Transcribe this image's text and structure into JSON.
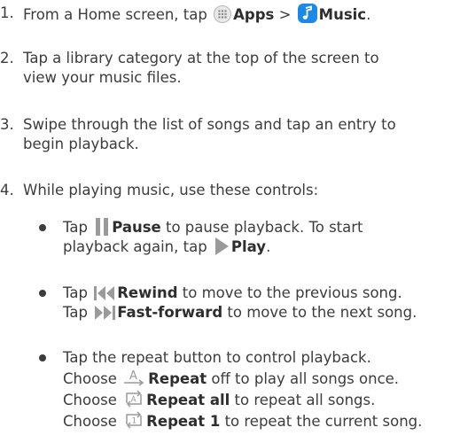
{
  "steps": [
    {
      "num": "1.",
      "pre": "From a Home screen, tap",
      "apps": "Apps",
      "sep": ">",
      "music": "Music",
      "end": "."
    },
    {
      "num": "2.",
      "line1": "Tap a library category at the top of the screen to",
      "line2": "view your music files."
    },
    {
      "num": "3.",
      "line1": "Swipe through the list of songs and tap an entry to",
      "line2": "begin playback."
    },
    {
      "num": "4.",
      "line1": "While playing music, use these controls:"
    }
  ],
  "bullets": {
    "pause": {
      "pre": "Tap",
      "label": "Pause",
      "post": "to pause playback. To start",
      "line2_pre": "playback again, tap",
      "play": "Play",
      "end": "."
    },
    "rewind": {
      "pre": "Tap",
      "label": "Rewind",
      "post": "to move to the previous song.",
      "pre2": "Tap",
      "ff": "Fast-forward",
      "post2": "to move to the next song."
    },
    "repeat": {
      "intro": "Tap the repeat button to control playback.",
      "choose": "Choose",
      "off_label": "Repeat",
      "off_post": "off to play all songs once.",
      "all_label": "Repeat all",
      "all_post": "to repeat all songs.",
      "one_label": "Repeat 1",
      "one_post": "to repeat the current song."
    }
  },
  "icons": [
    "apps-icon",
    "music-app-icon",
    "pause-icon",
    "play-icon",
    "rewind-icon",
    "fast-forward-icon",
    "repeat-off-icon",
    "repeat-all-icon",
    "repeat-one-icon"
  ],
  "colors": {
    "text": "#3c3c3c",
    "icon_gray": "#9a9a9a",
    "music_blue": "#1e88e5"
  }
}
